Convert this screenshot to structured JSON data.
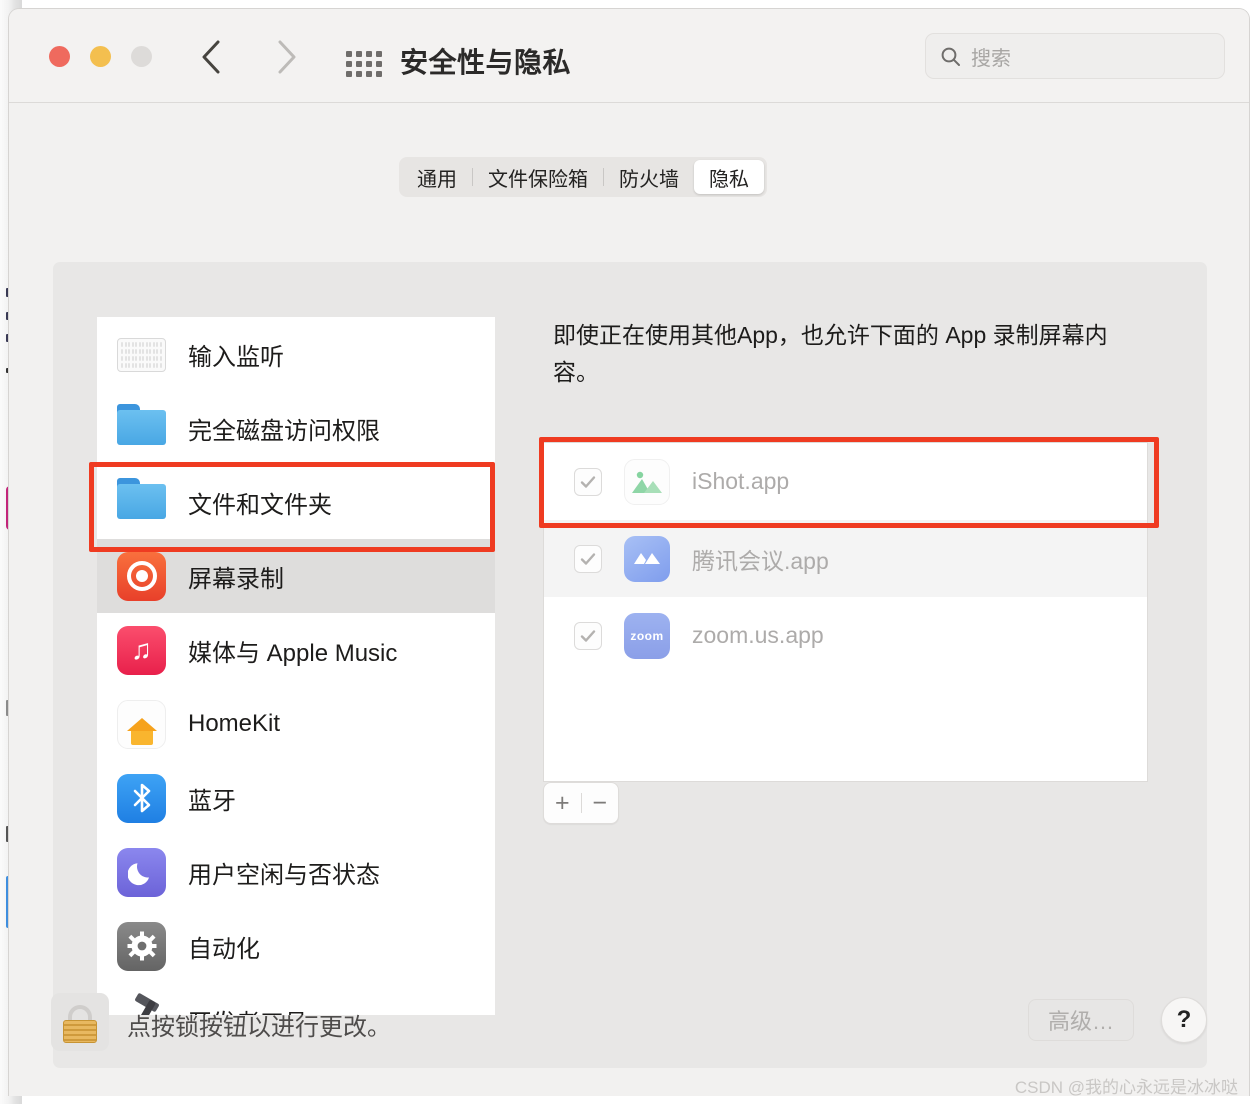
{
  "window": {
    "title": "安全性与隐私",
    "traffic_lights": [
      "close-button",
      "minimize-button",
      "zoom-button"
    ],
    "nav": {
      "back": "back-chevron",
      "forward": "forward-chevron",
      "grid": "show-all-grid"
    },
    "search": {
      "placeholder": "搜索",
      "value": "",
      "icon": "search-icon"
    }
  },
  "tabs": [
    {
      "label": "通用",
      "active": false
    },
    {
      "label": "文件保险箱",
      "active": false
    },
    {
      "label": "防火墙",
      "active": false
    },
    {
      "label": "隐私",
      "active": true
    }
  ],
  "sidebar": {
    "items": [
      {
        "label": "输入监听",
        "icon": "keyboard-icon",
        "selected": false
      },
      {
        "label": "完全磁盘访问权限",
        "icon": "folder-icon",
        "selected": false
      },
      {
        "label": "文件和文件夹",
        "icon": "folder-icon",
        "selected": false
      },
      {
        "label": "屏幕录制",
        "icon": "screen-recording-icon",
        "selected": true
      },
      {
        "label": "媒体与 Apple Music",
        "icon": "music-icon",
        "selected": false
      },
      {
        "label": "HomeKit",
        "icon": "homekit-icon",
        "selected": false
      },
      {
        "label": "蓝牙",
        "icon": "bluetooth-icon",
        "selected": false
      },
      {
        "label": "用户空闲与否状态",
        "icon": "moon-icon",
        "selected": false
      },
      {
        "label": "自动化",
        "icon": "gear-icon",
        "selected": false
      },
      {
        "label": "开发者工具",
        "icon": "xcode-icon",
        "selected": false
      }
    ]
  },
  "panel": {
    "description": "即使正在使用其他App，也允许下面的 App 录制屏幕内容。",
    "apps": [
      {
        "name": "iShot.app",
        "checked": true,
        "icon": "ishot-icon"
      },
      {
        "name": "腾讯会议.app",
        "checked": true,
        "icon": "tencent-meeting-icon"
      },
      {
        "name": "zoom.us.app",
        "checked": true,
        "icon": "zoom-icon"
      }
    ],
    "add_label": "+",
    "remove_label": "−"
  },
  "footer": {
    "lock_text": "点按锁按钮以进行更改。",
    "lock_icon": "locked-padlock-icon",
    "advanced_label": "高级…",
    "help_label": "?"
  },
  "watermark": "CSDN @我的心永远是冰冰哒",
  "colors": {
    "annotation_red": "#ef3b21",
    "selected_row": "#dedddc",
    "window_bg": "#f2f1f0"
  }
}
